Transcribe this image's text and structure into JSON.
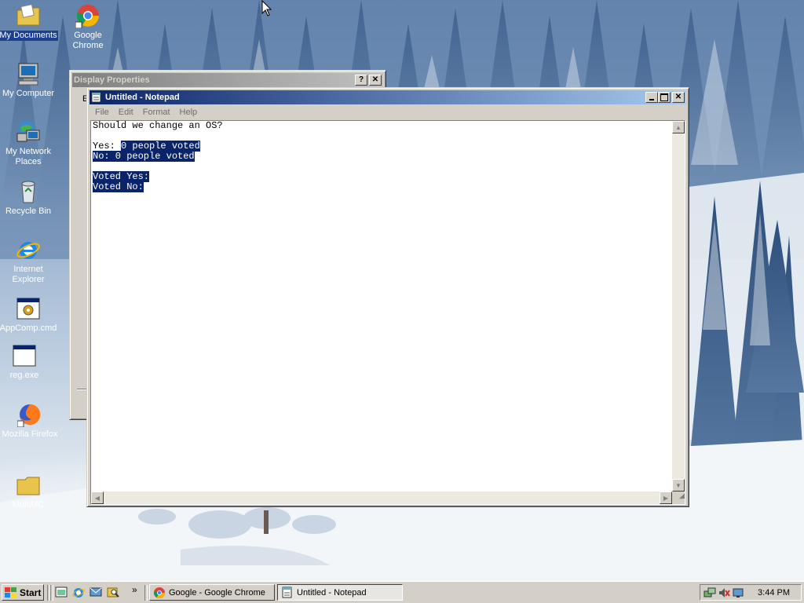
{
  "desktop": {
    "icons": [
      {
        "label": "My Documents",
        "icon": "folder-documents-icon"
      },
      {
        "label": "Google Chrome",
        "icon": "chrome-icon"
      },
      {
        "label": "My Computer",
        "icon": "computer-icon"
      },
      {
        "label": "My Network Places",
        "icon": "network-icon"
      },
      {
        "label": "Recycle Bin",
        "icon": "recycle-bin-icon"
      },
      {
        "label": "Internet Explorer",
        "icon": "ie-icon"
      },
      {
        "label": "AppComp.cmd",
        "icon": "cmd-icon"
      },
      {
        "label": "reg.exe",
        "icon": "exe-icon"
      },
      {
        "label": "Mozilla Firefox",
        "icon": "firefox-icon"
      },
      {
        "label": "MultiMC",
        "icon": "folder-icon"
      }
    ]
  },
  "display_properties": {
    "title": "Display Properties",
    "help_button": "?",
    "close_button": "✕",
    "partial_text": "E"
  },
  "notepad": {
    "title": "Untitled - Notepad",
    "menu": [
      "File",
      "Edit",
      "Format",
      "Help"
    ],
    "lines": {
      "l1": "Should we change an OS?",
      "l3_prefix": "Yes: ",
      "l3_sel": "0 people voted",
      "l4_sel": "No: 0 people voted",
      "l6_sel": "Voted Yes:",
      "l7_sel": "Voted No:"
    }
  },
  "taskbar": {
    "start_label": "Start",
    "quick_launch": [
      "desktop-icon",
      "ie-icon",
      "outlook-icon",
      "search-icon"
    ],
    "overflow": "»",
    "tasks": [
      {
        "label": "Google - Google Chrome",
        "icon": "chrome-icon",
        "active": false
      },
      {
        "label": "Untitled - Notepad",
        "icon": "notepad-icon",
        "active": true
      }
    ],
    "clock": "3:44 PM"
  },
  "colors": {
    "active_title": "#0a246a",
    "selection": "#0a246a",
    "face": "#d4d0c8"
  }
}
